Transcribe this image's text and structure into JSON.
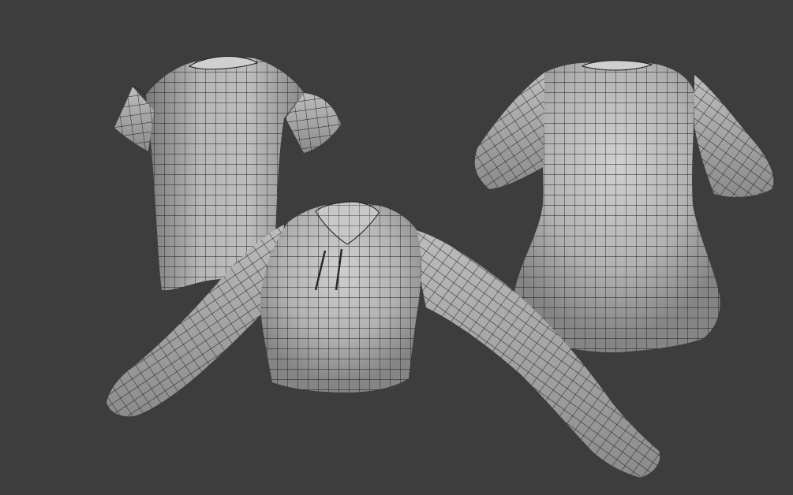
{
  "scene": {
    "background": "#3d3d3d",
    "mesh_fill": "#a9a9a9",
    "mesh_shade": "#6f6f6f",
    "mesh_highlight": "#cfcfcf",
    "wire_color": "#1e1e1e",
    "objects": [
      {
        "id": "tshirt-male",
        "kind": "short-sleeve t-shirt"
      },
      {
        "id": "tshirt-female",
        "kind": "short-sleeve fitted t-shirt"
      },
      {
        "id": "cropped-long-sleeve",
        "kind": "cropped long-sleeve top with zip"
      }
    ]
  }
}
